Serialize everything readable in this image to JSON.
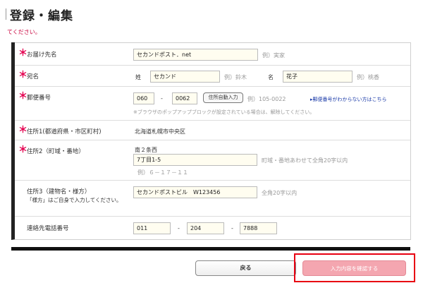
{
  "header": {
    "title": "登録・編集",
    "notice": "てください。"
  },
  "form": {
    "recipient": {
      "label": "お届け先名",
      "value": "セカンドポスト．net",
      "example": "例）実家"
    },
    "name": {
      "label": "宛名",
      "last_label": "姓",
      "last_value": "セカンド",
      "last_example": "例）鈴木",
      "first_label": "名",
      "first_value": "花子",
      "first_example": "例）桃香"
    },
    "postal": {
      "label": "郵便番号",
      "part1": "060",
      "separator": "-",
      "part2": "0062",
      "autofill_button": "住所自動入力",
      "example": "例）105-0022",
      "lookup_link": "▸郵便番号がわからない方はこちら",
      "popup_note": "※ブラウザのポップアップブロックが設定されている場合は、解除してください。"
    },
    "address1": {
      "label": "住所1(都道府県・市区町村)",
      "value": "北海道札幌市中央区"
    },
    "address2": {
      "label": "住所2（町域・番地）",
      "static_value": "南２条西",
      "value": "7丁目1-5",
      "note": "町域・番地あわせて全角20字以内",
      "example": "例）６－１７－１１"
    },
    "address3": {
      "label": "住所3（建物名・様方）",
      "sub_label": "「様方」はご自身で入力してください。",
      "value": "セカンドポストビル　W123456",
      "note": "全角20字以内"
    },
    "phone": {
      "label": "連絡先電話番号",
      "part1": "011",
      "sep1": "-",
      "part2": "204",
      "sep2": "-",
      "part3": "7888"
    },
    "required_mark": "＊"
  },
  "actions": {
    "back_label": "戻る",
    "confirm_label": "入力内容を確認する"
  },
  "colors": {
    "required": "#e4004f",
    "confirm_button": "#f4a6b0",
    "highlight_border": "#e80012",
    "link": "#1a3aa8"
  }
}
